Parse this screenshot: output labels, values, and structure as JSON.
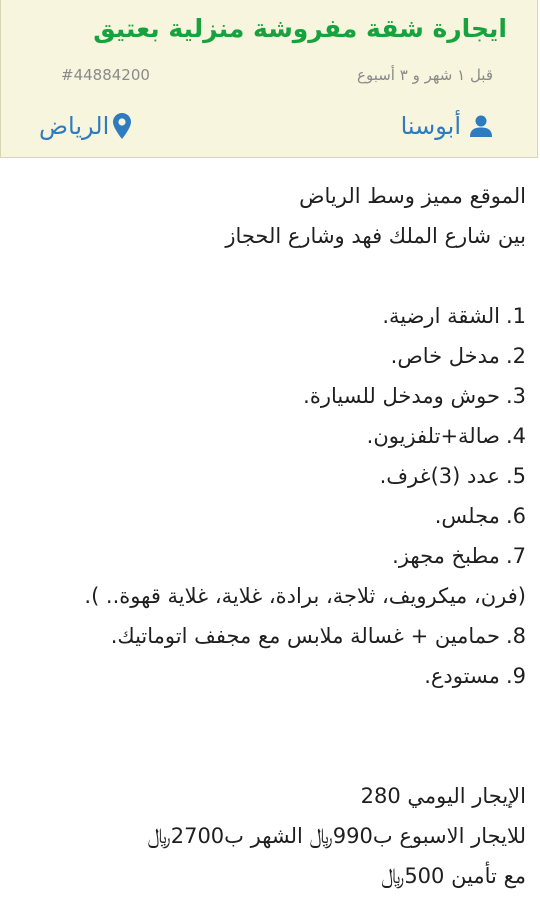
{
  "listing": {
    "title": "ايجارة شقة مفروشة منزلية بعتيق",
    "posted_ago": "قبل ١ شهر و ٣ أسبوع",
    "ad_id": "#44884200",
    "author": "أبوسنا",
    "city": "الرياض",
    "accent_color": "#16a33e",
    "link_color": "#2e7bbf"
  },
  "description": {
    "intro_line1": "الموقع مميز وسط الرياض",
    "intro_line2": "بين شارع الملك فهد وشارع الحجاز",
    "features": [
      {
        "num": "1.",
        "text": "الشقة ارضية."
      },
      {
        "num": "2.",
        "text": "مدخل خاص."
      },
      {
        "num": "3.",
        "text": "حوش ومدخل للسيارة."
      },
      {
        "num": "4.",
        "text": "صالة+تلفزيون."
      },
      {
        "num": "5.",
        "text": "عدد (3)غرف."
      },
      {
        "num": "6.",
        "text": "مجلس."
      },
      {
        "num": "7.",
        "text": "مطبخ مجهز."
      },
      {
        "num": "",
        "text": "(فرن، ميكرويف، ثلاجة، برادة، غلاية، غلاية قهوة.. )."
      },
      {
        "num": "8.",
        "text": "حمامين + غسالة ملابس مع مجفف اتوماتيك."
      },
      {
        "num": "9.",
        "text": "مستودع."
      }
    ],
    "daily_rent": "الإيجار اليومي 280",
    "weekly_monthly": "للايجار الاسبوع ب990﷼ الشهر ب2700﷼",
    "deposit": "مع تأمين 500﷼"
  },
  "icons": {
    "author_icon": "user-icon",
    "location_icon": "map-pin-icon"
  }
}
